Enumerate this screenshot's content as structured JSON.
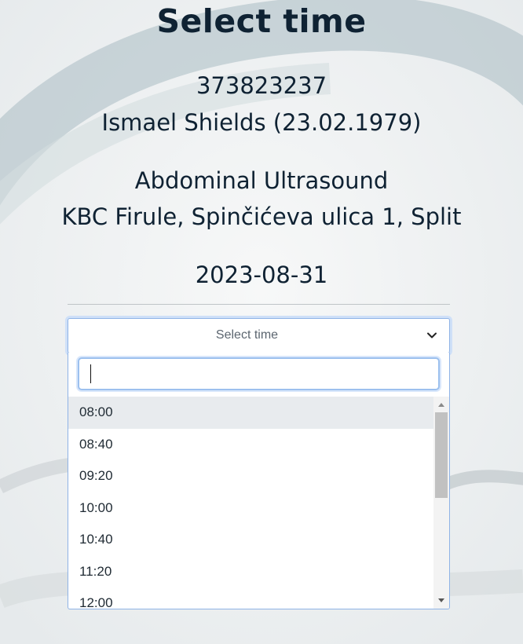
{
  "page": {
    "title": "Select time"
  },
  "patient": {
    "id": "373823237",
    "name_dob": "Ismael Shields (23.02.1979)"
  },
  "appointment": {
    "exam": "Abdominal Ultrasound",
    "location": "KBC Firule, Spinčićeva ulica 1, Split",
    "date": "2023-08-31"
  },
  "time_select": {
    "placeholder": "Select time",
    "search_value": "",
    "options": [
      "08:00",
      "08:40",
      "09:20",
      "10:00",
      "10:40",
      "11:20",
      "12:00"
    ],
    "highlighted": "08:00"
  },
  "colors": {
    "accent": "#8fb3e6",
    "text": "#0f2233",
    "highlight": "#e8ebee"
  },
  "icons": {
    "select_chevron": "chevron-down-icon",
    "scroll_up": "scroll-up-arrow-icon",
    "scroll_down": "scroll-down-arrow-icon"
  }
}
